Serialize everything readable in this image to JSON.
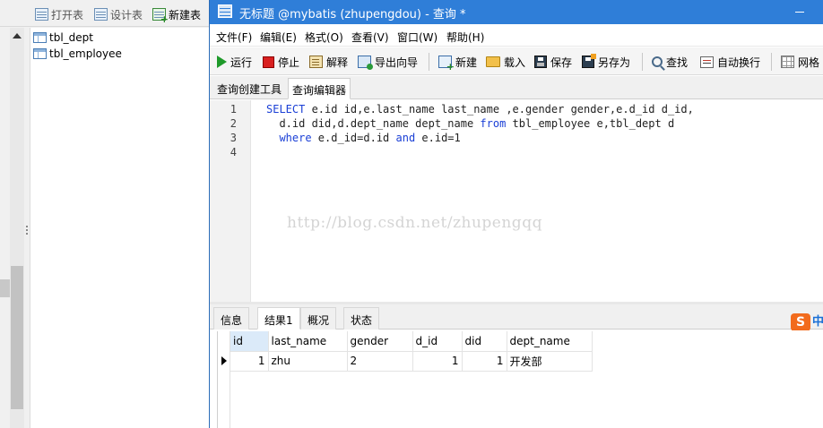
{
  "navigator": {
    "toolbar": {
      "open_table": "打开表",
      "design_table": "设计表",
      "new_table": "新建表"
    },
    "tables": [
      "tbl_dept",
      "tbl_employee"
    ]
  },
  "window": {
    "title": "无标题 @mybatis (zhupengdou) - 查询 *"
  },
  "menu": {
    "file": "文件(F)",
    "edit": "编辑(E)",
    "format": "格式(O)",
    "view": "查看(V)",
    "window": "窗口(W)",
    "help": "帮助(H)"
  },
  "toolbar": {
    "run": "运行",
    "stop": "停止",
    "explain": "解释",
    "export_wizard": "导出向导",
    "new": "新建",
    "load": "载入",
    "save": "保存",
    "save_as": "另存为",
    "find": "查找",
    "word_wrap": "自动换行",
    "grid": "网格"
  },
  "editor_tabs": {
    "query_builder": "查询创建工具",
    "query_editor": "查询编辑器"
  },
  "editor": {
    "line_numbers": [
      "1",
      "2",
      "3",
      "4"
    ],
    "line1": {
      "kw1": "SELECT",
      "text1": " e.id id,e.last_name last_name ,e.gender gender,e.d_id d_id,"
    },
    "line2": {
      "text1": "  d.id did,d.dept_name dept_name ",
      "kw1": "from",
      "text2": " tbl_employee e,tbl_dept d"
    },
    "line3": {
      "kw1": "where",
      "text1": " e.d_id=d.id ",
      "kw2": "and",
      "text2": " e.id=1"
    },
    "watermark": "http://blog.csdn.net/zhupengqq"
  },
  "result_tabs": {
    "info": "信息",
    "result1": "结果1",
    "overview": "概况",
    "status": "状态"
  },
  "ime": {
    "logo": "S",
    "mode": "中"
  },
  "results": {
    "columns": [
      "id",
      "last_name",
      "gender",
      "d_id",
      "did",
      "dept_name"
    ],
    "rows": [
      [
        "1",
        "zhu",
        "2",
        "1",
        "1",
        "开发部"
      ]
    ]
  }
}
